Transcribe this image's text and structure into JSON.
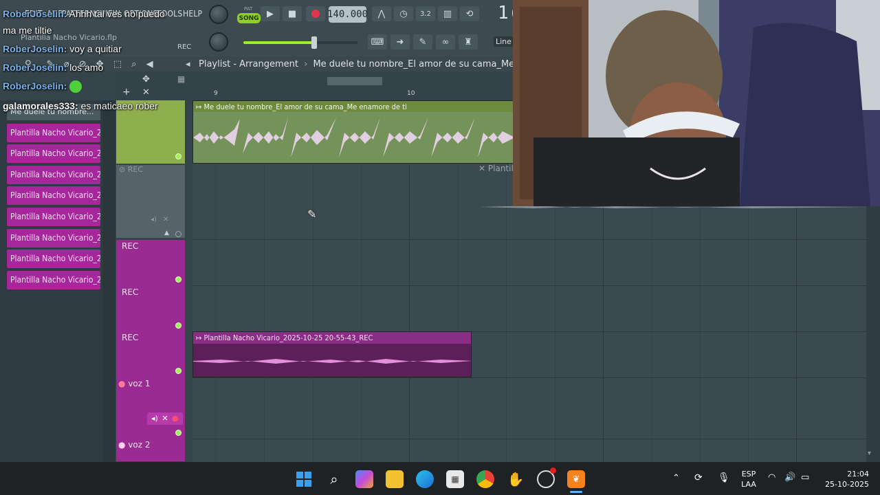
{
  "toolbar": {
    "menu_items": [
      "EDIT",
      "ADD",
      "PATTERNS",
      "VIEW",
      "OPTIONS",
      "TOOLS",
      "HELP"
    ],
    "pat_label": "PAT",
    "song_label": "SONG",
    "tempo": "140.000",
    "record_label": "REC",
    "time_partial": "1(",
    "snap_label": "Line",
    "file_name": "Plantilla Nacho Vicario.flp",
    "master_volume": 0.62
  },
  "playlist": {
    "title": "Playlist - Arrangement",
    "breadcrumb_sep": "›",
    "current_pattern": "Me duele tu nombre_El amor de su cama_Me enamore de ti",
    "ruler": [
      "9",
      "10"
    ]
  },
  "sidebar": {
    "first_item": "Me duele tu nombre...",
    "items": [
      "Plantilla Nacho Vicario_2...",
      "Plantilla Nacho Vicario_2...",
      "Plantilla Nacho Vicario_2...",
      "Plantilla Nacho Vicario_2...",
      "Plantilla Nacho Vicario_2...",
      "Plantilla Nacho Vicario_2...",
      "Plantilla Nacho Vicario_2...",
      "Plantilla Nacho Vicario_2...",
      "Plantilla Nacho Vicario_2..."
    ]
  },
  "tracks": {
    "rec_1": "REC",
    "rec_2": "REC",
    "rec_3": "REC",
    "rec_4": "REC",
    "voz1": "voz 1",
    "voz2": "voz 2"
  },
  "clips": {
    "top_clip": "Me duele tu nombre_El amor de su cama_Me enamore de ti",
    "cut_clip": "Plantil",
    "rec_clip": "Plantilla Nacho Vicario_2025-10-25 20-55-43_REC"
  },
  "chat": [
    {
      "user": "RoberJoselin:",
      "text": "Ahhh tal ves no puedo",
      "color": "#7ab0e8"
    },
    {
      "user": "",
      "text": "ma me tiltie",
      "color": "#ffffff"
    },
    {
      "user": "RoberJoselin:",
      "text": "voy a quitiar",
      "color": "#7ab0e8"
    },
    {
      "user": "RoberJoselin:",
      "text": "los amo",
      "color": "#7ab0e8"
    },
    {
      "user": "RoberJoselin:",
      "text": "",
      "color": "#7ab0e8"
    },
    {
      "user": "galamorales333:",
      "text": "es maticaeo rober",
      "color": "#ffffff"
    }
  ],
  "taskbar": {
    "lang_top": "ESP",
    "lang_bottom": "LAA",
    "time": "21:04",
    "date": "25-10-2025"
  },
  "colors": {
    "pattern_purple": "#a8269c",
    "audio_green": "#6d8a3e",
    "accent_green": "#9ef02f"
  }
}
